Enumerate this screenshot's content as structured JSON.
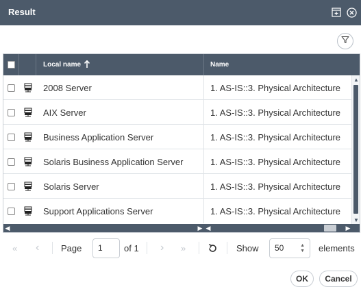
{
  "dialog": {
    "title": "Result"
  },
  "grid": {
    "columns": {
      "local_name": "Local name",
      "sort_arrow": "🠕",
      "name": "Name"
    },
    "rows": [
      {
        "local_name": "2008 Server",
        "name": "1. AS-IS::3. Physical Architecture"
      },
      {
        "local_name": "AIX Server",
        "name": "1. AS-IS::3. Physical Architecture"
      },
      {
        "local_name": "Business Application Server",
        "name": "1. AS-IS::3. Physical Architecture"
      },
      {
        "local_name": "Solaris Business Application Server",
        "name": "1. AS-IS::3. Physical Architecture"
      },
      {
        "local_name": "Solaris Server",
        "name": "1. AS-IS::3. Physical Architecture"
      },
      {
        "local_name": "Support Applications Server",
        "name": "1. AS-IS::3. Physical Architecture"
      }
    ]
  },
  "pager": {
    "first": "«",
    "prev": "‹",
    "page_label": "Page",
    "page_value": "1",
    "of_label": "of 1",
    "next": "›",
    "last": "»",
    "show_label": "Show",
    "page_size": "50",
    "elements_label": "elements"
  },
  "buttons": {
    "ok": "OK",
    "cancel": "Cancel"
  },
  "icons": {
    "row_icon": "server-icon",
    "filter": "filter-icon",
    "maximize": "maximize-icon",
    "close": "close-circle-icon",
    "refresh": "refresh-icon"
  },
  "colors": {
    "header_bg": "#4c5a6a",
    "border": "#c9ced4"
  }
}
